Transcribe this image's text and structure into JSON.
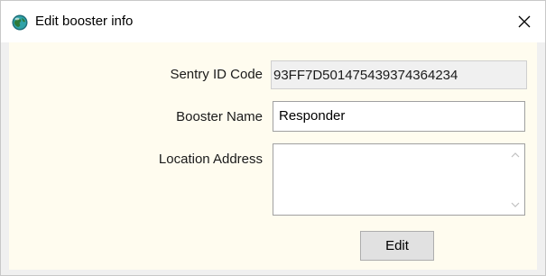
{
  "window": {
    "title": "Edit booster info",
    "title_icon": "app-globe-icon",
    "close_icon": "close-icon"
  },
  "form": {
    "sentry_id": {
      "label": "Sentry ID Code",
      "value": "93FF7D501475439374364234"
    },
    "booster_name": {
      "label": "Booster Name",
      "value": "Responder"
    },
    "location_address": {
      "label": "Location Address",
      "value": ""
    },
    "edit_button": {
      "label": "Edit"
    }
  },
  "colors": {
    "client_bg": "#fffcef",
    "frame_bg": "#f0f0f0",
    "button_bg": "#e1e1e1"
  }
}
